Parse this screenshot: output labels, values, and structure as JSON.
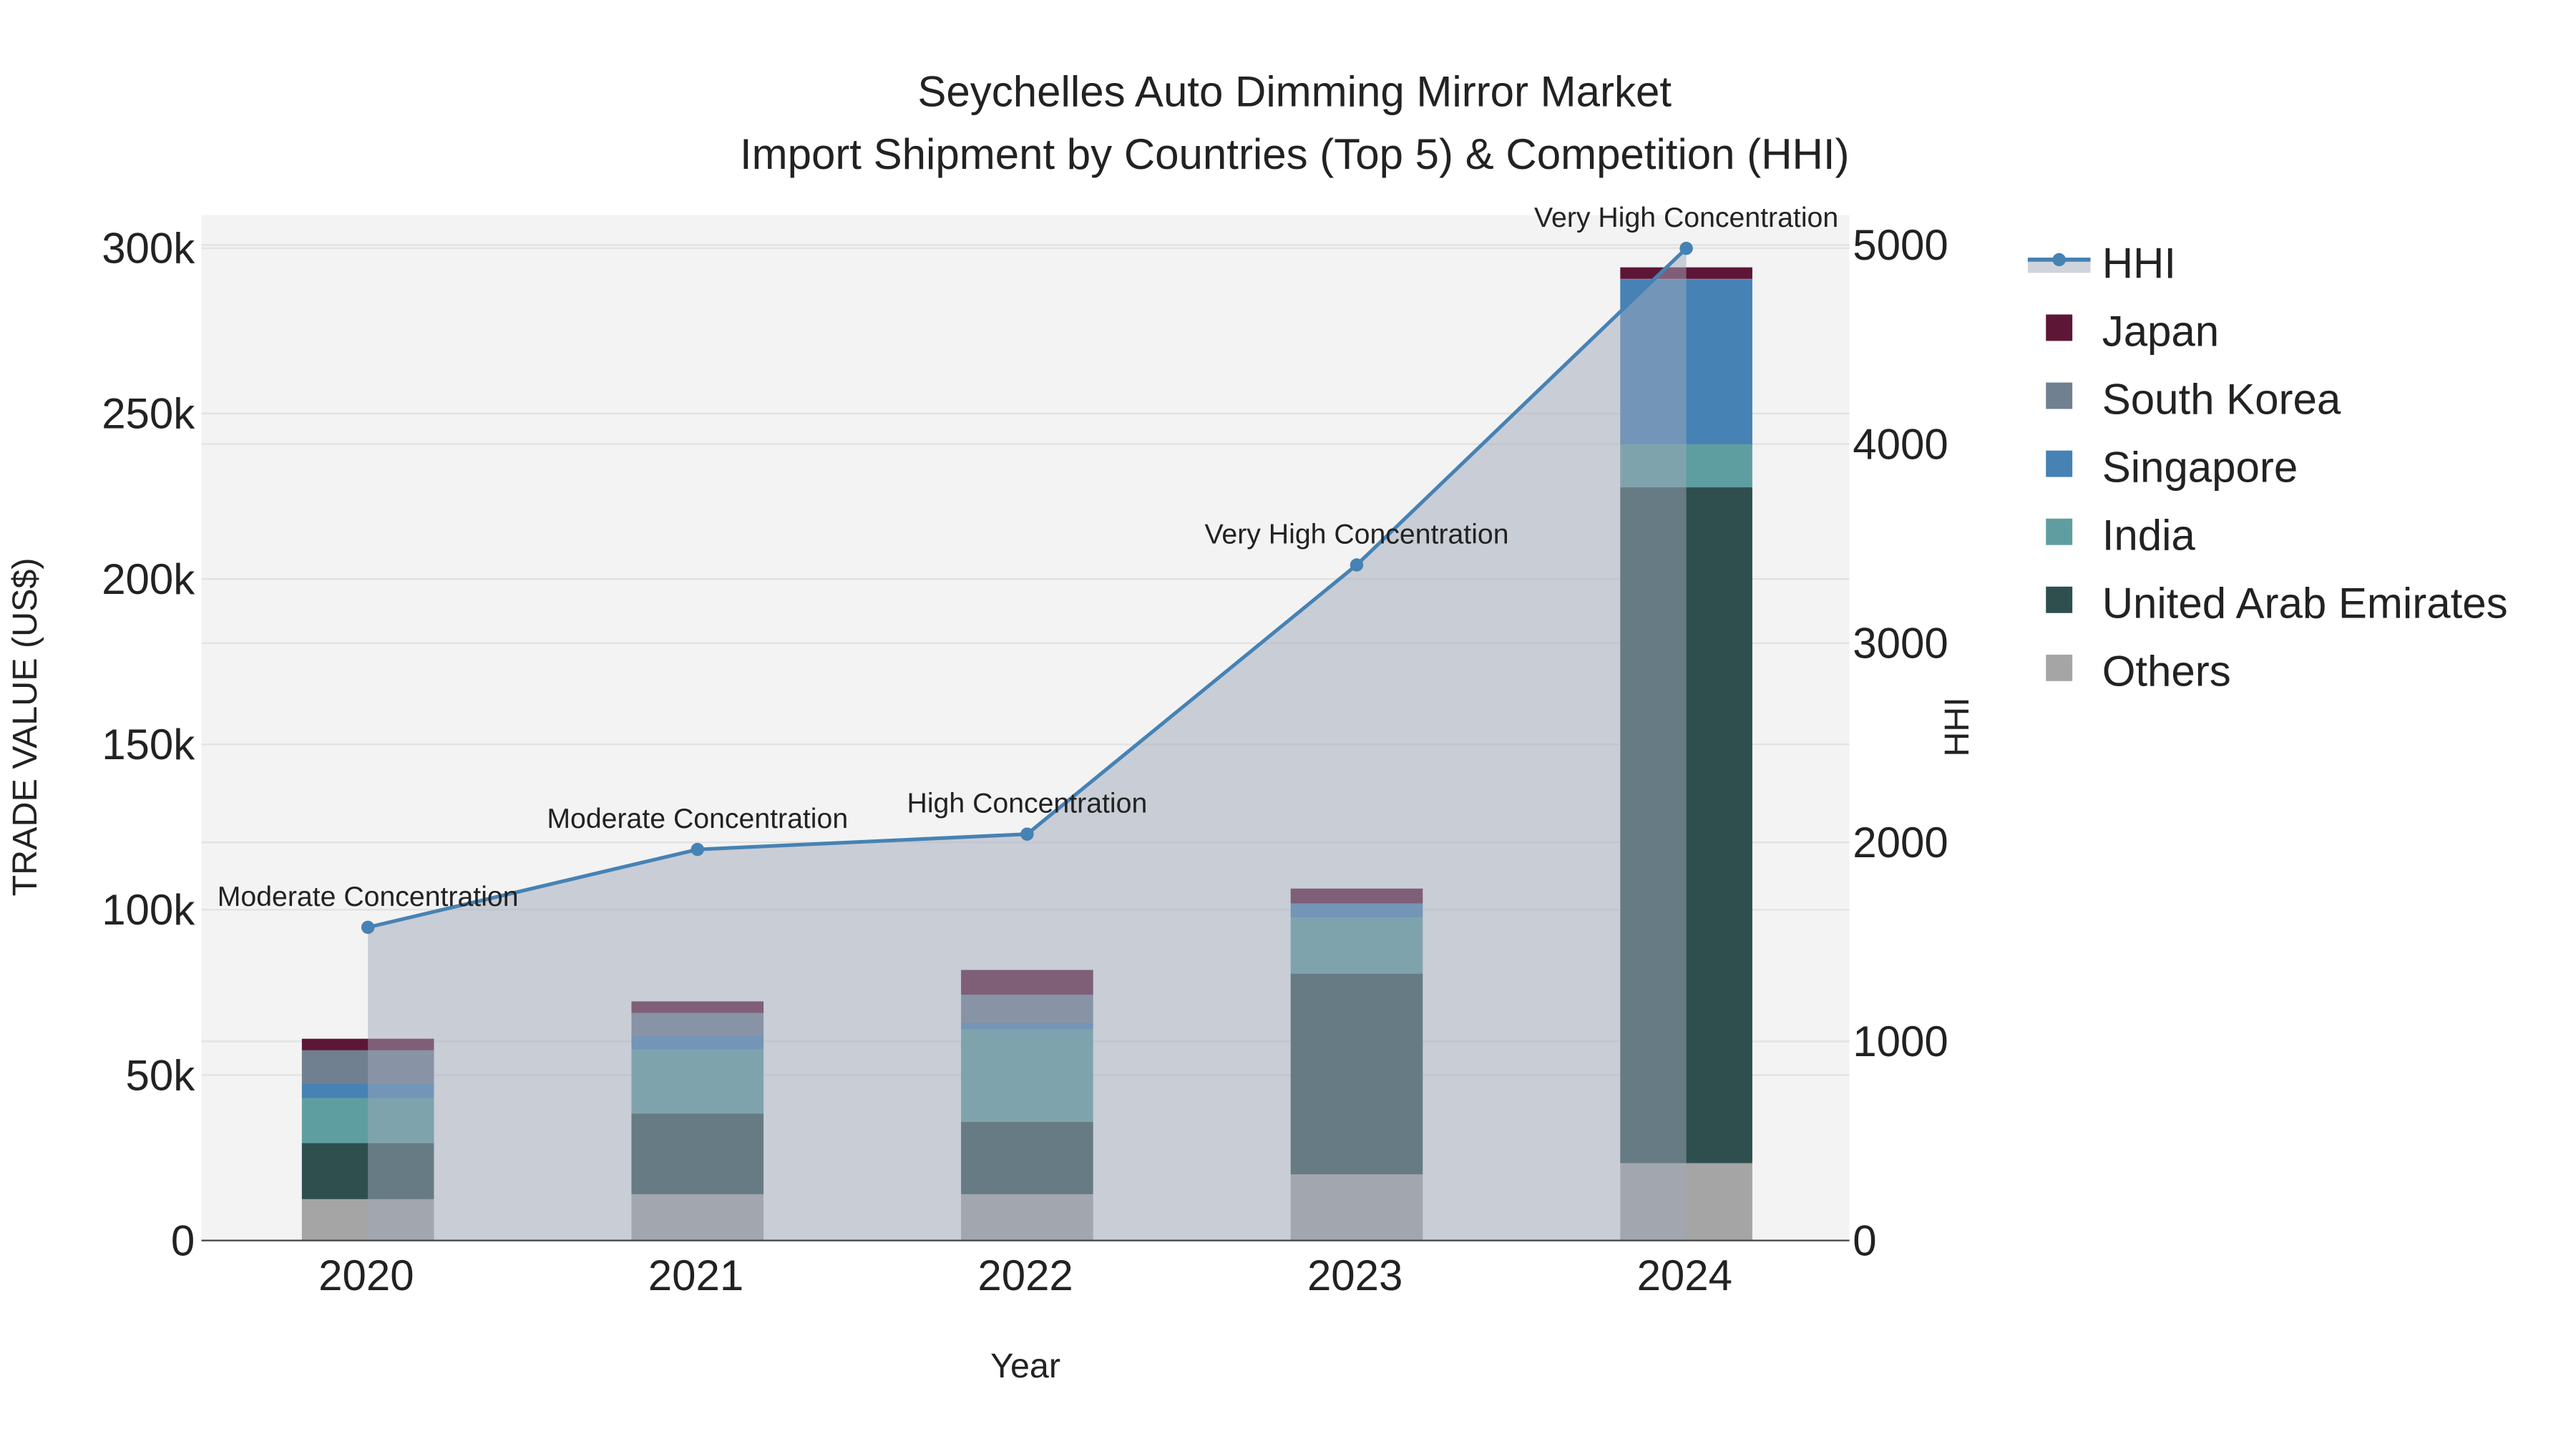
{
  "chart_data": {
    "type": "bar",
    "title": "Seychelles Auto Dimming Mirror Market",
    "subtitle": "Import Shipment by Countries (Top 5) & Competition (HHI)",
    "xlabel": "Year",
    "ylabel": "TRADE VALUE (US$)",
    "y2label": "HHI",
    "categories": [
      "2020",
      "2021",
      "2022",
      "2023",
      "2024"
    ],
    "ylim": [
      0,
      310000
    ],
    "y_ticks": [
      0,
      50000,
      100000,
      150000,
      200000,
      250000,
      300000
    ],
    "y_tick_labels": [
      "0",
      "50k",
      "100k",
      "150k",
      "200k",
      "250k",
      "300k"
    ],
    "y2lim": [
      0,
      5150
    ],
    "y2_ticks": [
      0,
      1000,
      2000,
      3000,
      4000,
      5000
    ],
    "y2_tick_labels": [
      "0",
      "1000",
      "2000",
      "3000",
      "4000",
      "5000"
    ],
    "stacked": true,
    "series": [
      {
        "name": "Others",
        "color": "#a5a5a5",
        "values": [
          12500,
          14000,
          14000,
          20000,
          23400
        ]
      },
      {
        "name": "United Arab Emirates",
        "color": "#2f4f4f",
        "values": [
          17000,
          24400,
          21900,
          60700,
          204300
        ]
      },
      {
        "name": "India",
        "color": "#5f9ea0",
        "values": [
          13500,
          19400,
          27900,
          17000,
          13000
        ]
      },
      {
        "name": "Singapore",
        "color": "#4682b4",
        "values": [
          4500,
          4000,
          2000,
          4000,
          49800
        ]
      },
      {
        "name": "South Korea",
        "color": "#708090",
        "values": [
          10000,
          7000,
          8500,
          200,
          200
        ]
      },
      {
        "name": "Japan",
        "color": "#5e1636",
        "values": [
          3500,
          3500,
          7500,
          4500,
          3500
        ]
      }
    ],
    "hhi": {
      "name": "HHI",
      "color": "#4682b4",
      "values": [
        1573,
        1964,
        2041,
        3393,
        4983
      ],
      "labels": [
        "Moderate Concentration",
        "Moderate Concentration",
        "High Concentration",
        "Very High Concentration",
        "Very High Concentration"
      ]
    },
    "legend_order": [
      "HHI",
      "Japan",
      "South Korea",
      "Singapore",
      "India",
      "United Arab Emirates",
      "Others"
    ],
    "legend_position": "right",
    "grid": true
  }
}
